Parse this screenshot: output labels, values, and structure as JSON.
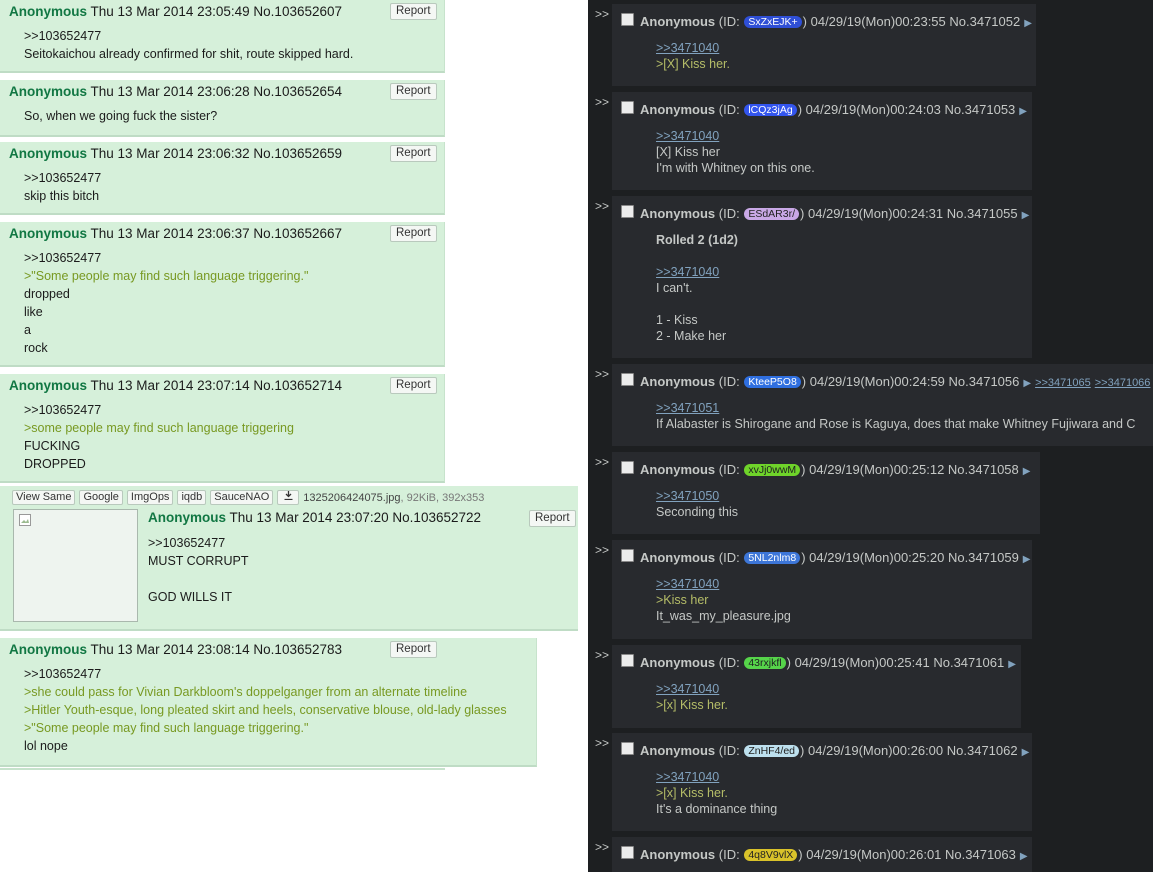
{
  "left": {
    "posts": [
      {
        "name": "Anonymous",
        "date": "Thu 13 Mar 2014 23:05:49",
        "no": "No.103652607",
        "report": "Report",
        "lines": [
          {
            "t": ">>103652477",
            "q": false
          },
          {
            "t": "Seitokaichou already confirmed for shit, route skipped hard.",
            "q": false
          }
        ]
      },
      {
        "name": "Anonymous",
        "date": "Thu 13 Mar 2014 23:06:28",
        "no": "No.103652654",
        "report": "Report",
        "lines": [
          {
            "t": "So, when we going fuck the sister?",
            "q": false
          }
        ]
      },
      {
        "name": "Anonymous",
        "date": "Thu 13 Mar 2014 23:06:32",
        "no": "No.103652659",
        "report": "Report",
        "lines": [
          {
            "t": ">>103652477",
            "q": false
          },
          {
            "t": "skip this bitch",
            "q": false
          }
        ]
      },
      {
        "name": "Anonymous",
        "date": "Thu 13 Mar 2014 23:06:37",
        "no": "No.103652667",
        "report": "Report",
        "lines": [
          {
            "t": ">>103652477",
            "q": false
          },
          {
            "t": ">\"Some people may find such language triggering.\"",
            "q": true
          },
          {
            "t": "dropped",
            "q": false
          },
          {
            "t": "like",
            "q": false
          },
          {
            "t": "a",
            "q": false
          },
          {
            "t": "rock",
            "q": false
          }
        ]
      },
      {
        "name": "Anonymous",
        "date": "Thu 13 Mar 2014 23:07:14",
        "no": "No.103652714",
        "report": "Report",
        "lines": [
          {
            "t": ">>103652477",
            "q": false
          },
          {
            "t": ">some people may find such language triggering",
            "q": true
          },
          {
            "t": "FUCKING",
            "q": false
          },
          {
            "t": "DROPPED",
            "q": false
          }
        ]
      },
      {
        "name": "Anonymous",
        "date": "Thu 13 Mar 2014 23:07:20",
        "no": "No.103652722",
        "report": "Report",
        "lines": [
          {
            "t": ">>103652477",
            "q": false
          },
          {
            "t": "MUST CORRUPT",
            "q": false
          },
          {
            "t": "",
            "q": false
          },
          {
            "t": "GOD WILLS IT",
            "q": false
          }
        ]
      },
      {
        "name": "Anonymous",
        "date": "Thu 13 Mar 2014 23:08:14",
        "no": "No.103652783",
        "report": "Report",
        "lines": [
          {
            "t": ">>103652477",
            "q": false
          },
          {
            "t": ">she could pass for Vivian Darkbloom's doppelganger from an alternate timeline",
            "q": true
          },
          {
            "t": ">Hitler Youth-esque, long pleated skirt and heels, conservative blouse, old-lady glasses",
            "q": true
          },
          {
            "t": ">\"Some people may find such language triggering.\"",
            "q": true
          },
          {
            "t": "lol nope",
            "q": false
          }
        ]
      }
    ],
    "image_tools": [
      "View Same",
      "Google",
      "ImgOps",
      "iqdb",
      "SauceNAO"
    ],
    "file_info": {
      "name": "1325206424075.jpg",
      "meta": ", 92KiB, 392x353"
    }
  },
  "right": {
    "sep": ">>",
    "id_label": "(ID:",
    "id_close": ")",
    "posts": [
      {
        "name": "Anonymous",
        "id": "SxZxEJK+",
        "id_color": "#2f4fd6",
        "id_text": "#ffffff",
        "date": "04/29/19(Mon)00:23:55",
        "no": "No.3471052",
        "backlinks": [],
        "lines": [
          {
            "t": ">>3471040",
            "k": "link"
          },
          {
            "t": ">[X] Kiss her.",
            "k": "quote"
          }
        ]
      },
      {
        "name": "Anonymous",
        "id": "lCQz3jAg",
        "id_color": "#3355ee",
        "id_text": "#ffffff",
        "date": "04/29/19(Mon)00:24:03",
        "no": "No.3471053",
        "backlinks": [],
        "lines": [
          {
            "t": ">>3471040",
            "k": "link"
          },
          {
            "t": "[X] Kiss her",
            "k": "text"
          },
          {
            "t": "I'm with Whitney on this one.",
            "k": "text"
          }
        ]
      },
      {
        "name": "Anonymous",
        "id": "ESdAR3r/",
        "id_color": "#c9a8e6",
        "id_text": "#222222",
        "date": "04/29/19(Mon)00:24:31",
        "no": "No.3471055",
        "backlinks": [],
        "lines": [
          {
            "t": "Rolled 2 (1d2)",
            "k": "roll"
          },
          {
            "t": "",
            "k": "text"
          },
          {
            "t": ">>3471040",
            "k": "link"
          },
          {
            "t": "I can't.",
            "k": "text"
          },
          {
            "t": "",
            "k": "text"
          },
          {
            "t": "1 - Kiss",
            "k": "text"
          },
          {
            "t": "2 - Make her",
            "k": "text"
          }
        ]
      },
      {
        "name": "Anonymous",
        "id": "KteeP5O8",
        "id_color": "#2f6fe0",
        "id_text": "#ffffff",
        "date": "04/29/19(Mon)00:24:59",
        "no": "No.3471056",
        "backlinks": [
          ">>3471065",
          ">>3471066"
        ],
        "lines": [
          {
            "t": ">>3471051",
            "k": "link"
          },
          {
            "t": "If Alabaster is Shirogane and Rose is Kaguya, does that make Whitney Fujiwara and C",
            "k": "text"
          }
        ]
      },
      {
        "name": "Anonymous",
        "id": "xvJj0wwM",
        "id_color": "#6fd42a",
        "id_text": "#1d1f21",
        "date": "04/29/19(Mon)00:25:12",
        "no": "No.3471058",
        "backlinks": [],
        "lines": [
          {
            "t": ">>3471050",
            "k": "link"
          },
          {
            "t": "Seconding this",
            "k": "text"
          }
        ]
      },
      {
        "name": "Anonymous",
        "id": "5NL2nlm8",
        "id_color": "#3d76d8",
        "id_text": "#ffffff",
        "date": "04/29/19(Mon)00:25:20",
        "no": "No.3471059",
        "backlinks": [],
        "lines": [
          {
            "t": ">>3471040",
            "k": "link"
          },
          {
            "t": ">Kiss her",
            "k": "quote"
          },
          {
            "t": "It_was_my_pleasure.jpg",
            "k": "text"
          }
        ]
      },
      {
        "name": "Anonymous",
        "id": "43rxjkfl",
        "id_color": "#56d44a",
        "id_text": "#1d1f21",
        "date": "04/29/19(Mon)00:25:41",
        "no": "No.3471061",
        "backlinks": [],
        "lines": [
          {
            "t": ">>3471040",
            "k": "link"
          },
          {
            "t": ">[x] Kiss her.",
            "k": "quote"
          }
        ]
      },
      {
        "name": "Anonymous",
        "id": "ZnHF4/ed",
        "id_color": "#bde0ee",
        "id_text": "#222222",
        "date": "04/29/19(Mon)00:26:00",
        "no": "No.3471062",
        "backlinks": [],
        "lines": [
          {
            "t": ">>3471040",
            "k": "link"
          },
          {
            "t": ">[x] Kiss her.",
            "k": "quote"
          },
          {
            "t": "It's a dominance thing",
            "k": "text"
          }
        ]
      },
      {
        "name": "Anonymous",
        "id": "4q8V9vlX",
        "id_color": "#d9c22a",
        "id_text": "#222222",
        "date": "04/29/19(Mon)00:26:01",
        "no": "No.3471063",
        "backlinks": [],
        "lines": []
      }
    ]
  }
}
